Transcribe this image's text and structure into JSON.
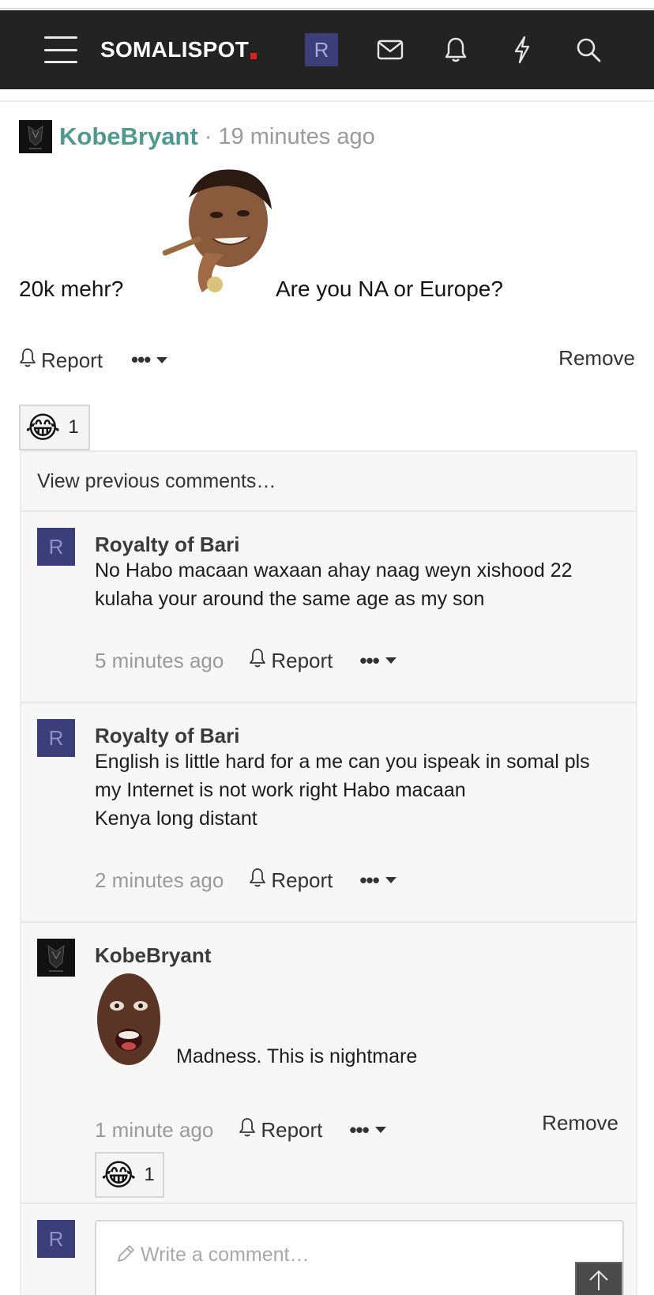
{
  "navbar": {
    "logo_text": "SOMALISPOT",
    "avatar_letter": "R",
    "icons": [
      "menu-icon",
      "envelope-icon",
      "bell-icon",
      "lightning-icon",
      "search-icon"
    ]
  },
  "post": {
    "author": "KobeBryant",
    "time": "· 19 minutes ago",
    "text_before_image": "20k mehr?",
    "text_after_image": "Are you NA or Europe?",
    "report_label": "Report",
    "more_label": "•••",
    "remove_label": "Remove",
    "reaction": {
      "emoji": "😂",
      "count": "1"
    }
  },
  "comments": {
    "view_previous": "View previous comments…",
    "items": [
      {
        "avatar_letter": "R",
        "author": "Royalty of Bari",
        "lines": [
          "No Habo macaan waxaan ahay naag weyn xishood 22",
          "kulaha your around the same age as my son"
        ],
        "time": "5 minutes ago",
        "report_label": "Report",
        "more_label": "•••"
      },
      {
        "avatar_letter": "R",
        "author": "Royalty of Bari",
        "lines": [
          "English is little hard for a me can you ispeak in somal pls",
          "my Internet is not work right Habo macaan",
          "Kenya long distant"
        ],
        "time": "2 minutes ago",
        "report_label": "Report",
        "more_label": "•••"
      },
      {
        "author": "KobeBryant",
        "text": "Madness. This is nightmare",
        "time": "1 minute ago",
        "report_label": "Report",
        "more_label": "•••",
        "remove_label": "Remove",
        "reaction": {
          "emoji": "😂",
          "count": "1"
        }
      }
    ]
  },
  "write_comment": {
    "avatar_letter": "R",
    "placeholder": "Write a comment…"
  },
  "colors": {
    "navbar_bg": "#232323",
    "author_link": "#4e9a90",
    "avatar_bg": "#3b3e78",
    "logo_dot": "#e02020"
  }
}
